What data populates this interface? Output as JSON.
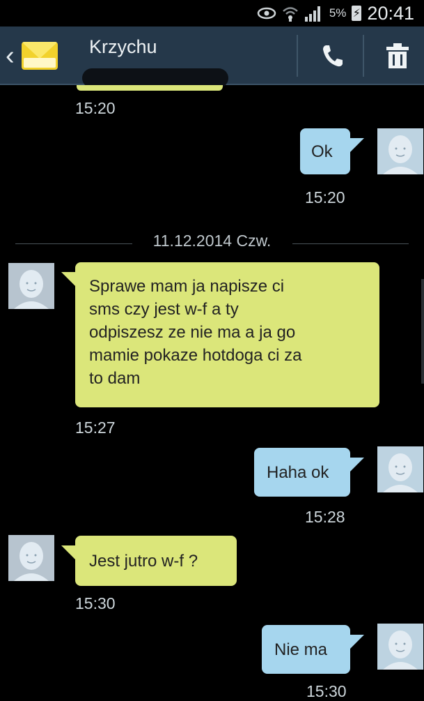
{
  "status": {
    "battery": "5%",
    "time": "20:41",
    "icons": [
      "eye-icon",
      "wifi-icon",
      "signal-icon",
      "charging-icon"
    ]
  },
  "header": {
    "contact_name": "Krzychu",
    "icons": [
      "back-chevron-icon",
      "envelope-icon",
      "phone-icon",
      "trash-icon"
    ]
  },
  "conversation": {
    "date_separator": "11.12.2014 Czw.",
    "messages": [
      {
        "direction": "in",
        "text": "",
        "time": "15:20"
      },
      {
        "direction": "out",
        "text": "Ok",
        "time": "15:20"
      },
      {
        "direction": "in",
        "lines": [
          "Sprawe mam ja napisze ci",
          "sms czy jest w-f a ty",
          "odpiszesz ze nie ma a ja go",
          "mamie pokaze hotdoga ci za",
          "to dam"
        ],
        "time": "15:27"
      },
      {
        "direction": "out",
        "text": "Haha ok",
        "time": "15:28"
      },
      {
        "direction": "in",
        "text": "Jest jutro w-f ?",
        "time": "15:30"
      },
      {
        "direction": "out",
        "text": "Nie ma",
        "time": "15:30"
      }
    ]
  },
  "colors": {
    "actionbar": "#25384a",
    "incoming_bubble": "#dbe67a",
    "outgoing_bubble": "#a6d6ee",
    "background": "#000000"
  }
}
